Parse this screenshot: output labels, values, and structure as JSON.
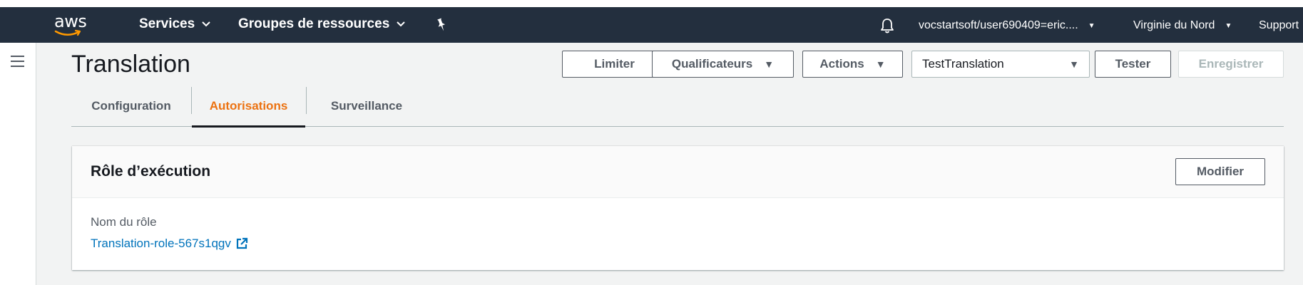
{
  "navbar": {
    "logo_text": "aws",
    "services_label": "Services",
    "resource_groups_label": "Groupes de ressources",
    "user_label": "vocstartsoft/user690409=eric....",
    "region_label": "Virginie du Nord",
    "support_label": "Support",
    "pin_icon": "pin-icon",
    "bell_icon": "bell-icon",
    "brand_color": "#232f3e",
    "logo_accent": "#ff9900"
  },
  "page": {
    "title": "Translation"
  },
  "toolbar": {
    "limit_label": "Limiter",
    "qualifiers_label": "Qualificateurs",
    "actions_label": "Actions",
    "test_event_value": "TestTranslation",
    "test_label": "Tester",
    "save_label": "Enregistrer"
  },
  "tabs": [
    {
      "label": "Configuration",
      "active": false
    },
    {
      "label": "Autorisations",
      "active": true
    },
    {
      "label": "Surveillance",
      "active": false
    }
  ],
  "execution_role": {
    "title": "Rôle d’exécution",
    "modify_label": "Modifier",
    "role_name_label": "Nom du rôle",
    "role_name_value": "Translation-role-567s1qgv",
    "external_link_icon": "external-link-icon"
  },
  "colors": {
    "active_tab": "#ec7211",
    "link": "#0073bb"
  }
}
